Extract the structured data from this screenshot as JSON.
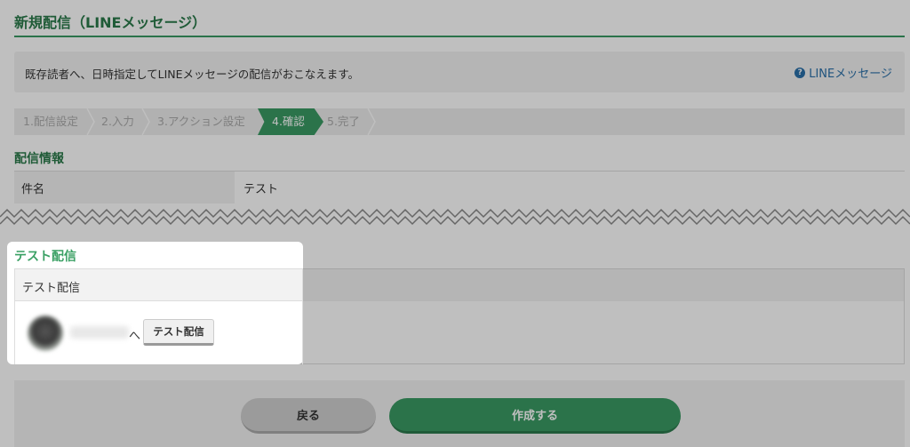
{
  "page": {
    "title": "新規配信（LINEメッセージ）",
    "description": "既存読者へ、日時指定してLINEメッセージの配信がおこなえます。",
    "help_link": "LINEメッセージ"
  },
  "steps": [
    "1.配信設定",
    "2.入力",
    "3.アクション設定",
    "4.確認",
    "5.完了"
  ],
  "active_step": "4.確認",
  "info_section": {
    "title": "配信情報",
    "rows": [
      {
        "label": "件名",
        "value": "テスト"
      }
    ]
  },
  "test_section": {
    "title": "テスト配信",
    "header": "テスト配信",
    "to_text": "へ",
    "button_label": "テスト配信"
  },
  "buttons": {
    "back": "戻る",
    "create": "作成する"
  },
  "colors": {
    "brand_green": "#3a9a63",
    "link_blue": "#2a6fa8"
  }
}
